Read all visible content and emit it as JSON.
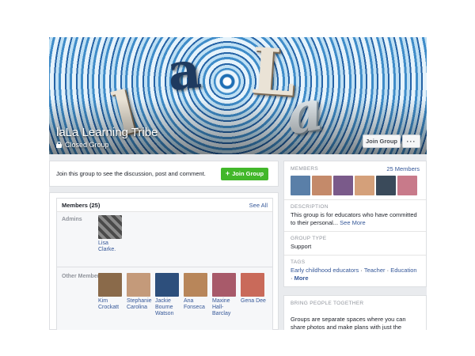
{
  "group": {
    "name": "laLa Learning Tribe",
    "privacy": "Closed Group",
    "cover_letters": [
      "l",
      "a",
      "L",
      "a"
    ],
    "join_label": "Join Group",
    "more_label": "···"
  },
  "join_prompt": {
    "text": "Join this group to see the discussion, post and comment.",
    "button_label": "Join Group",
    "button_color": "#42b72a"
  },
  "members_panel": {
    "title": "Members (25)",
    "see_all": "See All",
    "admins_label": "Admins",
    "admins": [
      {
        "name": "Lisa\nClarke.",
        "color": "#6b6b6b"
      }
    ],
    "other_label": "Other Members",
    "others": [
      {
        "name": "Kim\nCrockatt",
        "color": "#8a6a4a"
      },
      {
        "name": "Stephanie\nCarolina",
        "color": "#c49a7a"
      },
      {
        "name": "Jackie\nBourne\nWatson",
        "color": "#2d4f7c"
      },
      {
        "name": "Ana\nFonseca",
        "color": "#b8865a"
      },
      {
        "name": "Maxine\nHall-\nBarclay",
        "color": "#a85a6a"
      },
      {
        "name": "Gena Dee",
        "color": "#c96a5a"
      }
    ]
  },
  "sidebar": {
    "members_label": "MEMBERS",
    "members_count": "25 Members",
    "member_thumbs": [
      "#5a7fa8",
      "#c48a6a",
      "#7a5a8a",
      "#d4a07a",
      "#3a4a5a",
      "#c87a8a",
      "#a8506a",
      "#d46a6a"
    ],
    "description_label": "DESCRIPTION",
    "description_text": "This group is for educators who have committed to their personal...",
    "see_more": "See More",
    "group_type_label": "GROUP TYPE",
    "group_type": "Support",
    "tags_label": "TAGS",
    "tags": [
      "Early childhood educators",
      "Teacher",
      "Education",
      "More"
    ],
    "bring_label": "BRING PEOPLE TOGETHER",
    "bring_text": "Groups are separate spaces where you can share photos and make plans with just the people you"
  },
  "colors": {
    "link": "#365899",
    "page_bg": "#e9ebee"
  }
}
